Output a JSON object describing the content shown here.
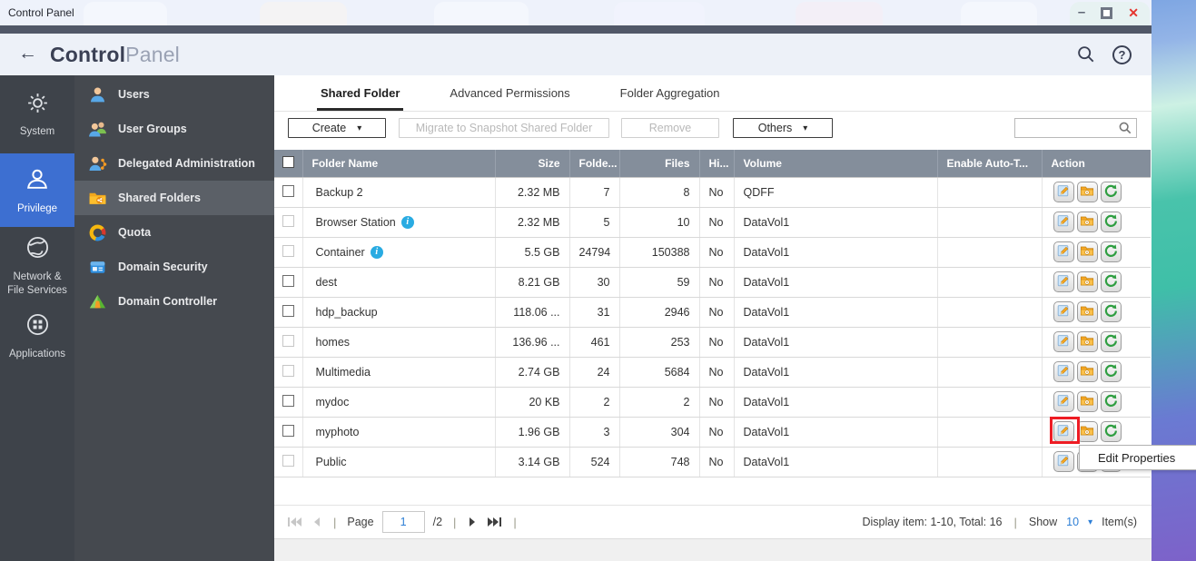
{
  "desktop": {
    "titlebar_title": "Control Panel"
  },
  "window_controls": {
    "minimize_glyph": "–",
    "close_glyph": "✕"
  },
  "app_header": {
    "back_glyph": "←",
    "title_bold": "Control",
    "title_light": "Panel",
    "help_glyph": "?"
  },
  "primary_nav": {
    "items": [
      {
        "id": "system",
        "label": "System",
        "active": false
      },
      {
        "id": "privilege",
        "label": "Privilege",
        "active": true
      },
      {
        "id": "network",
        "label": "Network &\nFile Services",
        "active": false
      },
      {
        "id": "applications",
        "label": "Applications",
        "active": false
      }
    ]
  },
  "secondary_nav": {
    "items": [
      {
        "id": "users",
        "label": "Users",
        "active": false
      },
      {
        "id": "user-groups",
        "label": "User Groups",
        "active": false
      },
      {
        "id": "delegated-administration",
        "label": "Delegated Administration",
        "active": false
      },
      {
        "id": "shared-folders",
        "label": "Shared Folders",
        "active": true
      },
      {
        "id": "quota",
        "label": "Quota",
        "active": false
      },
      {
        "id": "domain-security",
        "label": "Domain Security",
        "active": false
      },
      {
        "id": "domain-controller",
        "label": "Domain Controller",
        "active": false
      }
    ]
  },
  "tabs": [
    {
      "label": "Shared Folder",
      "active": true
    },
    {
      "label": "Advanced Permissions",
      "active": false
    },
    {
      "label": "Folder Aggregation",
      "active": false
    }
  ],
  "toolbar": {
    "create_label": "Create",
    "migrate_label": "Migrate to Snapshot Shared Folder",
    "remove_label": "Remove",
    "others_label": "Others",
    "dropdown_glyph": "▾",
    "search_value": ""
  },
  "table": {
    "info_glyph": "i",
    "columns": [
      "Folder Name",
      "Size",
      "Folde...",
      "Files",
      "Hi...",
      "Volume",
      "Enable Auto-T...",
      "Action"
    ],
    "rows": [
      {
        "name": "Backup 2",
        "info": false,
        "size": "2.32 MB",
        "folders": "7",
        "files": "8",
        "hidden": "No",
        "volume": "QDFF",
        "auto": "",
        "checkbox": "enabled"
      },
      {
        "name": "Browser Station",
        "info": true,
        "size": "2.32 MB",
        "folders": "5",
        "files": "10",
        "hidden": "No",
        "volume": "DataVol1",
        "auto": "",
        "checkbox": "disabled"
      },
      {
        "name": "Container",
        "info": true,
        "size": "5.5 GB",
        "folders": "24794",
        "files": "150388",
        "hidden": "No",
        "volume": "DataVol1",
        "auto": "",
        "checkbox": "disabled"
      },
      {
        "name": "dest",
        "info": false,
        "size": "8.21 GB",
        "folders": "30",
        "files": "59",
        "hidden": "No",
        "volume": "DataVol1",
        "auto": "",
        "checkbox": "enabled"
      },
      {
        "name": "hdp_backup",
        "info": false,
        "size": "118.06 ...",
        "folders": "31",
        "files": "2946",
        "hidden": "No",
        "volume": "DataVol1",
        "auto": "",
        "checkbox": "enabled"
      },
      {
        "name": "homes",
        "info": false,
        "size": "136.96 ...",
        "folders": "461",
        "files": "253",
        "hidden": "No",
        "volume": "DataVol1",
        "auto": "",
        "checkbox": "disabled"
      },
      {
        "name": "Multimedia",
        "info": false,
        "size": "2.74 GB",
        "folders": "24",
        "files": "5684",
        "hidden": "No",
        "volume": "DataVol1",
        "auto": "",
        "checkbox": "disabled"
      },
      {
        "name": "mydoc",
        "info": false,
        "size": "20 KB",
        "folders": "2",
        "files": "2",
        "hidden": "No",
        "volume": "DataVol1",
        "auto": "",
        "checkbox": "enabled"
      },
      {
        "name": "myphoto",
        "info": false,
        "size": "1.96 GB",
        "folders": "3",
        "files": "304",
        "hidden": "No",
        "volume": "DataVol1",
        "auto": "",
        "checkbox": "enabled",
        "highlight_edit": true
      },
      {
        "name": "Public",
        "info": false,
        "size": "3.14 GB",
        "folders": "524",
        "files": "748",
        "hidden": "No",
        "volume": "DataVol1",
        "auto": "",
        "checkbox": "disabled"
      }
    ]
  },
  "pagination": {
    "page_label": "Page",
    "page_value": "1",
    "page_total": "/2",
    "divider_glyph": "|",
    "display_text": "Display item: 1-10, Total: 16",
    "show_label": "Show",
    "show_value": "10",
    "show_caret_glyph": "▾",
    "items_label": "Item(s)"
  },
  "tooltip": {
    "text": "Edit Properties"
  }
}
